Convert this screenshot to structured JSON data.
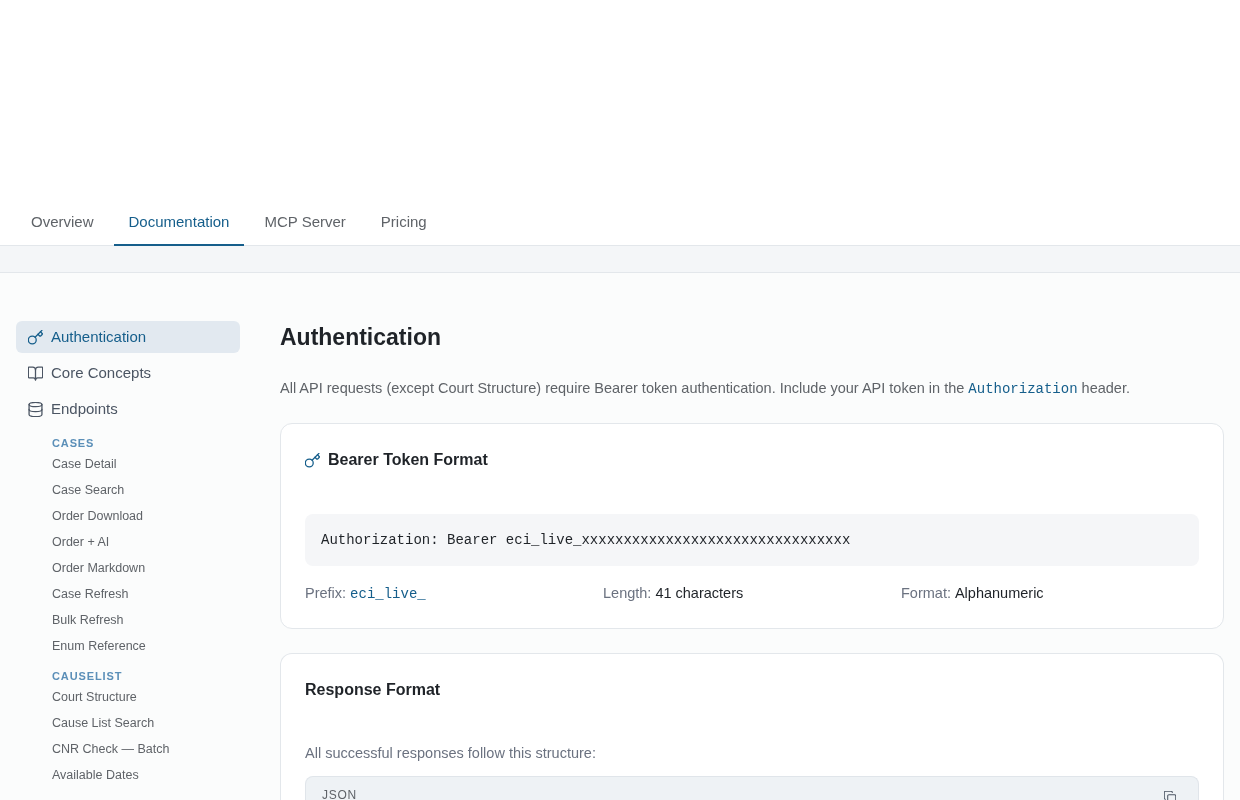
{
  "tabs": [
    {
      "label": "Overview",
      "selected": false
    },
    {
      "label": "Documentation",
      "selected": true
    },
    {
      "label": "MCP Server",
      "selected": false
    },
    {
      "label": "Pricing",
      "selected": false
    }
  ],
  "sidebar": {
    "items": [
      {
        "label": "Authentication",
        "selected": true
      },
      {
        "label": "Core Concepts",
        "selected": false
      },
      {
        "label": "Endpoints",
        "selected": false
      }
    ],
    "groups": [
      {
        "heading": "CASES",
        "items": [
          {
            "label": "Case Detail",
            "selected": false
          },
          {
            "label": "Case Search",
            "selected": false
          },
          {
            "label": "Order Download",
            "selected": false
          },
          {
            "label": "Order + AI",
            "selected": false
          },
          {
            "label": "Order Markdown",
            "selected": false
          },
          {
            "label": "Case Refresh",
            "selected": false
          },
          {
            "label": "Bulk Refresh",
            "selected": false
          },
          {
            "label": "Enum Reference",
            "selected": false
          }
        ]
      },
      {
        "heading": "CAUSELIST",
        "items": [
          {
            "label": "Court Structure",
            "selected": false
          },
          {
            "label": "Cause List Search",
            "selected": false
          },
          {
            "label": "CNR Check — Batch",
            "selected": false
          },
          {
            "label": "Available Dates",
            "selected": false
          }
        ]
      }
    ]
  },
  "page": {
    "title": "Authentication",
    "intro": [
      {
        "kind": "text",
        "text": "All API requests (except Court Structure) require Bearer token authentication. Include your API token in the "
      },
      {
        "kind": "code",
        "text": "Authorization"
      },
      {
        "kind": "text",
        "text": " header."
      }
    ],
    "cards": [
      {
        "kind": "token",
        "title": "Bearer Token Format",
        "code": "Authorization: Bearer eci_live_xxxxxxxxxxxxxxxxxxxxxxxxxxxxxxxx",
        "facts": [
          {
            "label": "Prefix:",
            "value": "eci_live_",
            "kind": "code"
          },
          {
            "label": "Length:",
            "value": "41 characters",
            "kind": "text"
          },
          {
            "label": "Format:",
            "value": "Alphanumeric",
            "kind": "text"
          }
        ]
      },
      {
        "kind": "response",
        "title": "Response Format",
        "text": "All successful responses follow this structure:",
        "code_block": {
          "language": "JSON"
        }
      }
    ]
  }
}
